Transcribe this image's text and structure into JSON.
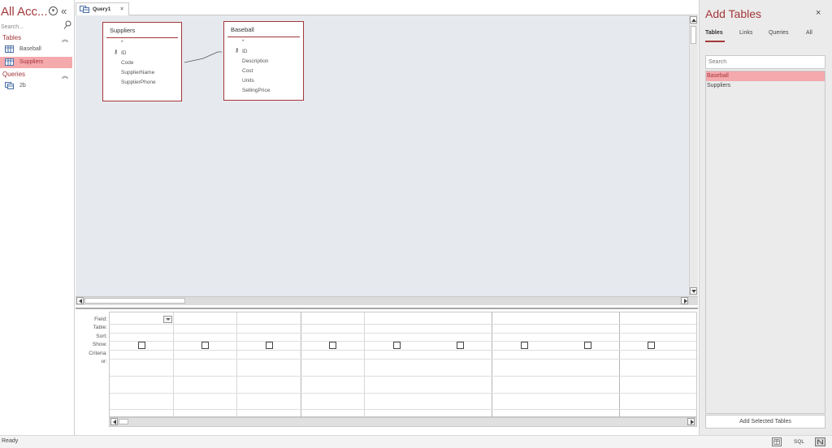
{
  "nav": {
    "title": "All Acc...",
    "search_placeholder": "Search...",
    "groups": {
      "tables": {
        "label": "Tables",
        "items": [
          "Baseball",
          "Suppliers"
        ]
      },
      "queries": {
        "label": "Queries",
        "items": [
          "2b"
        ]
      }
    },
    "selected_item": "Suppliers"
  },
  "document": {
    "tab_label": "Query1",
    "tab_close": "×"
  },
  "tables_in_query": [
    {
      "name": "Suppliers",
      "fields": [
        "*",
        "ID",
        "Code",
        "SupplierName",
        "SupplierPhone"
      ],
      "key_field": "ID"
    },
    {
      "name": "Baseball",
      "fields": [
        "*",
        "ID",
        "Description",
        "Cost",
        "Units",
        "SellingPrice"
      ],
      "key_field": "ID"
    }
  ],
  "grid": {
    "row_labels": [
      "Field:",
      "Table:",
      "Sort:",
      "Show:",
      "Criteria:",
      "or:"
    ]
  },
  "add_tables": {
    "title": "Add Tables",
    "close": "×",
    "tabs": [
      "Tables",
      "Links",
      "Queries",
      "All"
    ],
    "active_tab": "Tables",
    "search_placeholder": "Search",
    "items": [
      "Baseball",
      "Suppliers"
    ],
    "selected_item": "Baseball",
    "button_label": "Add Selected Tables"
  },
  "status": {
    "text": "Ready",
    "sql_label": "SQL"
  },
  "colors": {
    "accent": "#a4373a",
    "selection": "#f4a9ad"
  }
}
